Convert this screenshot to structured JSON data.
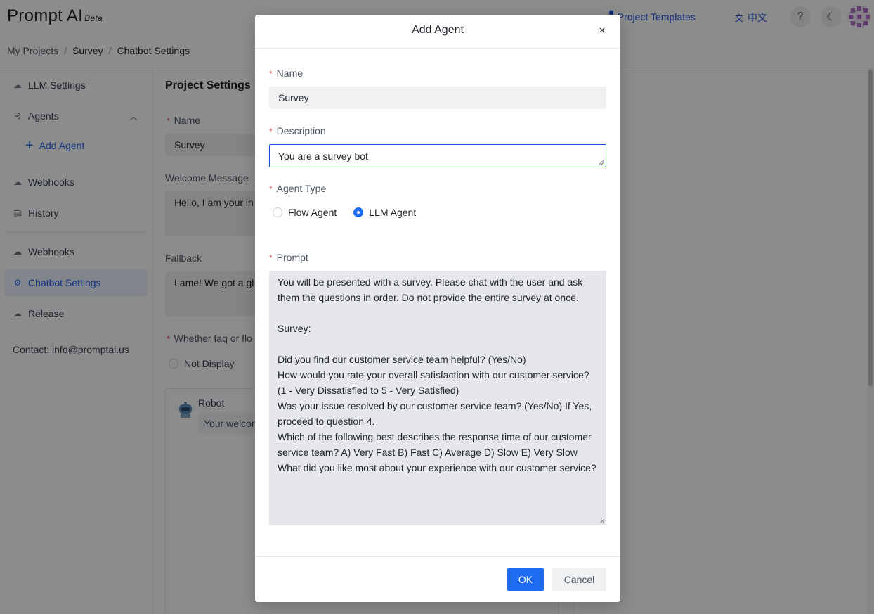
{
  "header": {
    "logo": "Prompt AI",
    "logo_badge": "Beta",
    "templates_link": "Project Templates",
    "language_link": "中文",
    "help_icon": "?"
  },
  "breadcrumb": [
    "My Projects",
    "Survey",
    "Chatbot Settings"
  ],
  "sidebar": {
    "items": [
      {
        "label": "LLM Settings",
        "icon": "cloud-icon"
      },
      {
        "label": "Agents",
        "icon": "agents-icon"
      },
      {
        "label": "Add Agent",
        "icon": "plus-icon"
      },
      {
        "label": "Webhooks",
        "icon": "cloud-icon"
      },
      {
        "label": "History",
        "icon": "history-icon"
      },
      {
        "label": "Webhooks",
        "icon": "cloud-icon"
      },
      {
        "label": "Chatbot Settings",
        "icon": "gear-icon",
        "active": true
      },
      {
        "label": "Release",
        "icon": "release-icon"
      }
    ],
    "contact": "Contact: info@promptai.us"
  },
  "main": {
    "title": "Project Settings",
    "name_label": "Name",
    "name_value": "Survey",
    "welcome_label": "Welcome Message",
    "welcome_value": "Hello, I am your in",
    "fallback_label": "Fallback",
    "fallback_value": "Lame! We got a gl",
    "faq_label": "Whether faq or flo",
    "faq_option": "Not Display",
    "robot_name": "Robot",
    "robot_message": "Your welcom"
  },
  "modal": {
    "title": "Add Agent",
    "close": "×",
    "name_label": "Name",
    "name_value": "Survey",
    "description_label": "Description",
    "description_value": "You are a survey bot",
    "agent_type_label": "Agent Type",
    "agent_types": [
      {
        "label": "Flow Agent",
        "selected": false
      },
      {
        "label": "LLM Agent",
        "selected": true
      }
    ],
    "prompt_label": "Prompt",
    "prompt_value": "You will be presented with a survey. Please chat with the user and ask them the questions in order. Do not provide the entire survey at once.\n\nSurvey:\n\nDid you find our customer service team helpful? (Yes/No)\nHow would you rate your overall satisfaction with our customer service? (1 - Very Dissatisfied to 5 - Very Satisfied)\nWas your issue resolved by our customer service team? (Yes/No) If Yes, proceed to question 4.\nWhich of the following best describes the response time of our customer service team? A) Very Fast B) Fast C) Average D) Slow E) Very Slow\nWhat did you like most about your experience with our customer service?",
    "ok_label": "OK",
    "cancel_label": "Cancel"
  },
  "required_mark": "*",
  "colors": {
    "accent": "#1d6bf2",
    "link": "#1d4ed8",
    "required": "#e34d59",
    "overlay": "rgba(0,0,0,0.45)"
  }
}
